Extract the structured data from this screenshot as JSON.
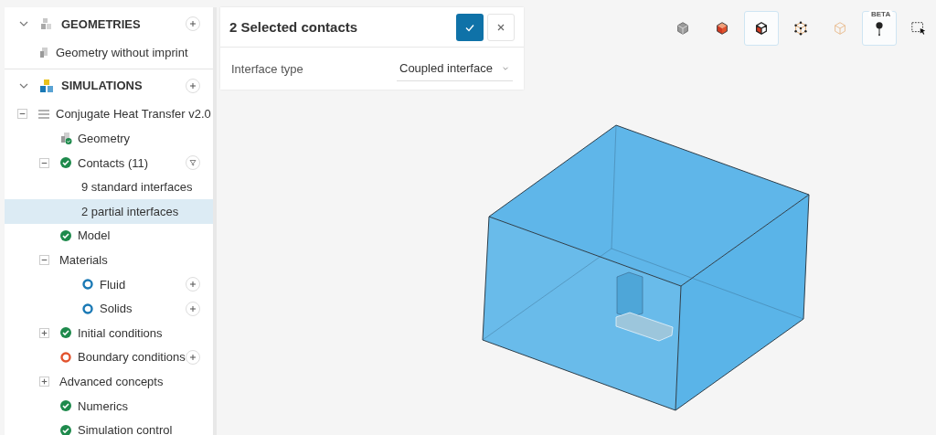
{
  "sidebar": {
    "sections": [
      {
        "title": "GEOMETRIES",
        "expanded": true,
        "kind": "geometries",
        "items": [
          {
            "label": "Geometry without imprint",
            "kind": "geometry",
            "selected": false
          }
        ]
      },
      {
        "title": "SIMULATIONS",
        "expanded": true,
        "kind": "simulations",
        "items": [
          {
            "label": "Conjugate Heat Transfer v2.0",
            "kind": "sim",
            "expanded": true,
            "selected": false,
            "children": [
              {
                "label": "Geometry",
                "kind": "geometry-ok",
                "selected": false
              },
              {
                "label": "Contacts (11)",
                "kind": "done-filter",
                "expanded": true,
                "selected": false,
                "children": [
                  {
                    "label": "9 standard interfaces",
                    "kind": "plain",
                    "selected": false
                  },
                  {
                    "label": "2 partial interfaces",
                    "kind": "plain",
                    "selected": true
                  }
                ]
              },
              {
                "label": "Model",
                "kind": "done",
                "selected": false
              },
              {
                "label": "Materials",
                "kind": "plain",
                "expanded": true,
                "selected": false,
                "children": [
                  {
                    "label": "Fluid",
                    "kind": "pending-add",
                    "selected": false
                  },
                  {
                    "label": "Solids",
                    "kind": "pending-add",
                    "selected": false
                  }
                ]
              },
              {
                "label": "Initial conditions",
                "kind": "done",
                "expanded": false,
                "selected": false
              },
              {
                "label": "Boundary conditions",
                "kind": "error-add",
                "selected": false
              },
              {
                "label": "Advanced concepts",
                "kind": "plain",
                "expanded": false,
                "selected": false
              },
              {
                "label": "Numerics",
                "kind": "done",
                "selected": false
              },
              {
                "label": "Simulation control",
                "kind": "done",
                "selected": false
              }
            ]
          }
        ]
      }
    ]
  },
  "panel": {
    "title": "2 Selected contacts",
    "field": {
      "label": "Interface type",
      "value": "Coupled interface"
    }
  },
  "toolbar": [
    {
      "kind": "cube-grey",
      "selected": false
    },
    {
      "kind": "cube-red",
      "selected": false
    },
    {
      "kind": "cube-red-outline",
      "selected": true
    },
    {
      "kind": "cube-vertices",
      "selected": false
    },
    {
      "kind": "cube-faint",
      "selected": false
    },
    {
      "kind": "pin",
      "selected": true,
      "badge": "BETA"
    },
    {
      "kind": "box-select",
      "selected": false
    }
  ]
}
